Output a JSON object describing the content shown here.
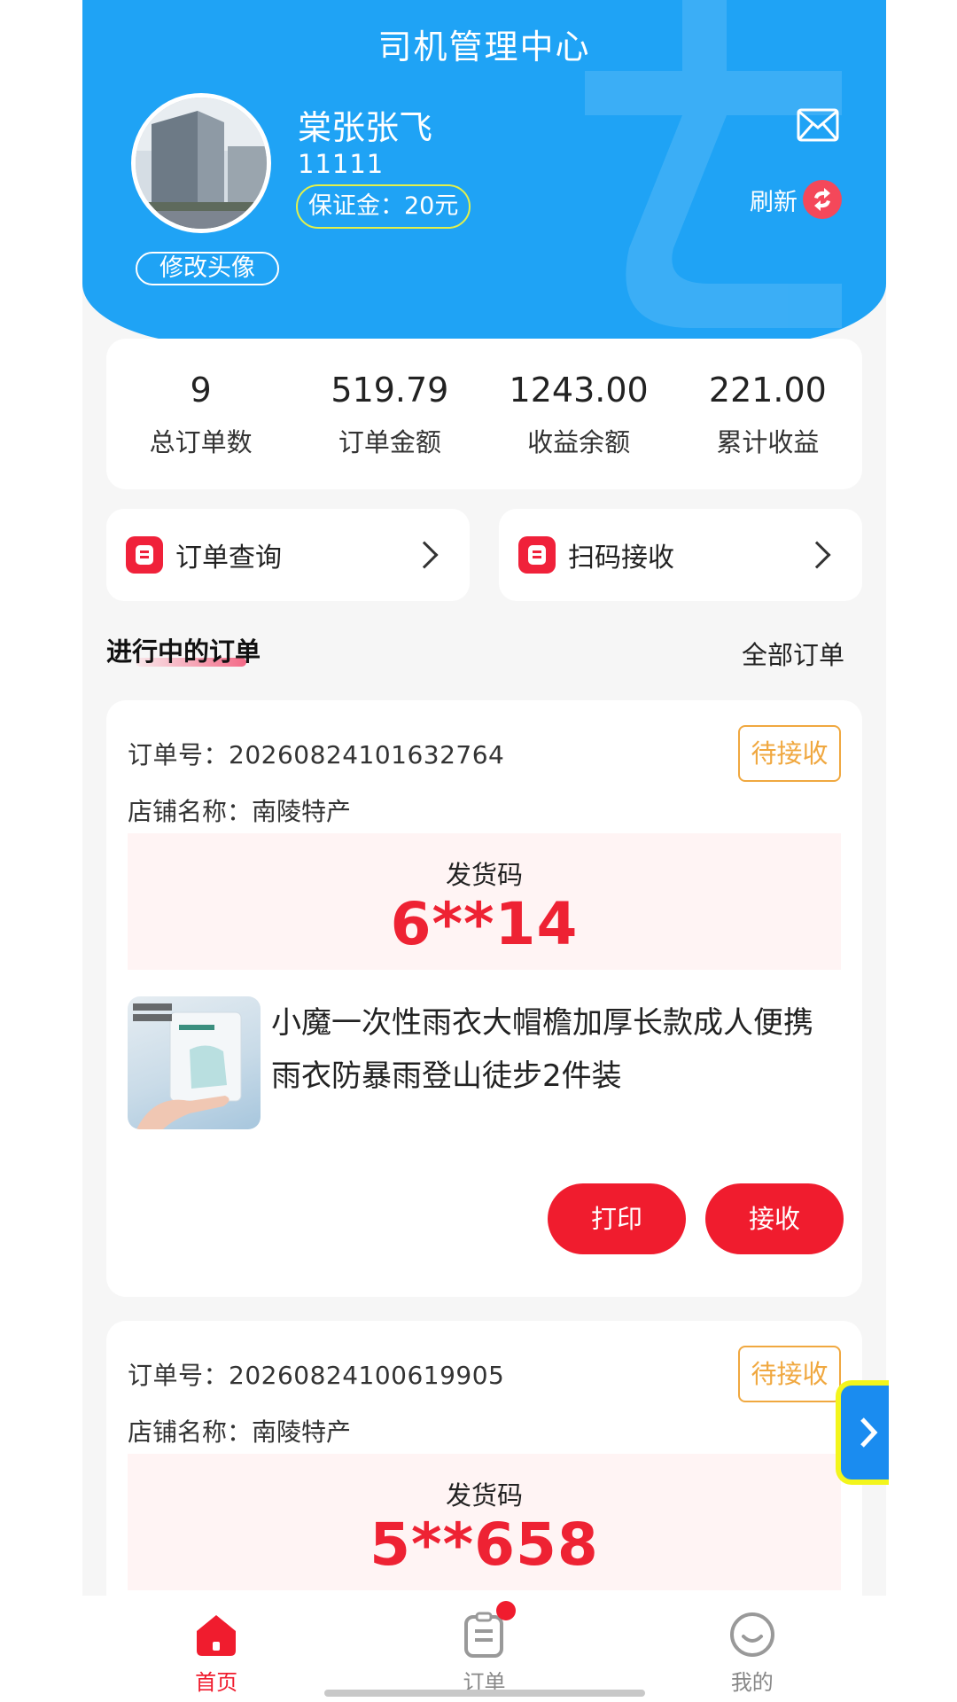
{
  "header": {
    "title": "司机管理中心",
    "change_avatar": "修改头像",
    "user_name": "棠张张飞",
    "user_id": "11111",
    "deposit": "保证金：20元",
    "refresh": "刷新"
  },
  "stats": [
    {
      "value": "9",
      "label": "总订单数"
    },
    {
      "value": "519.79",
      "label": "订单金额"
    },
    {
      "value": "1243.00",
      "label": "收益余额"
    },
    {
      "value": "221.00",
      "label": "累计收益"
    }
  ],
  "quick_actions": [
    {
      "label": "订单查询",
      "icon": "document-icon"
    },
    {
      "label": "扫码接收",
      "icon": "document-icon"
    }
  ],
  "section": {
    "title": "进行中的订单",
    "all_orders": "全部订单"
  },
  "orders": [
    {
      "order_no": "订单号：20260824101632764",
      "shop": "店铺名称：南陵特产",
      "status": "待接收",
      "code_label": "发货码",
      "code": "6**14",
      "product_title": "小魔一次性雨衣大帽檐加厚长款成人便携雨衣防暴雨登山徒步2件装",
      "print_label": "打印",
      "accept_label": "接收"
    },
    {
      "order_no": "订单号：20260824100619905",
      "shop": "店铺名称：南陵特产",
      "status": "待接收",
      "code_label": "发货码",
      "code": "5**658"
    }
  ],
  "nav": [
    {
      "label": "首页",
      "icon": "home-icon",
      "active": true
    },
    {
      "label": "订单",
      "icon": "clipboard-icon",
      "active": false
    },
    {
      "label": "我的",
      "icon": "smiley-icon",
      "active": false
    }
  ],
  "colors": {
    "header_blue": "#1fa3f5",
    "accent_red": "#f01c2e",
    "status_orange": "#f0a840",
    "deposit_border": "#e3f04b"
  }
}
